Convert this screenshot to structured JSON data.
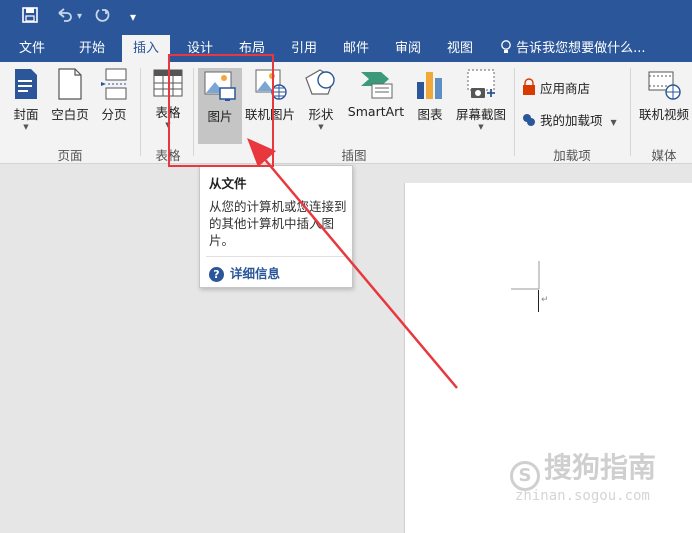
{
  "qat": {
    "save_icon": "save-icon",
    "undo_icon": "undo-icon",
    "redo_icon": "redo-icon",
    "customize_icon": "customize-icon"
  },
  "tabs": [
    {
      "label": "文件"
    },
    {
      "label": "开始"
    },
    {
      "label": "插入"
    },
    {
      "label": "设计"
    },
    {
      "label": "布局"
    },
    {
      "label": "引用"
    },
    {
      "label": "邮件"
    },
    {
      "label": "审阅"
    },
    {
      "label": "视图"
    }
  ],
  "tell_me": "告诉我您想要做什么...",
  "ribbon": {
    "pages": {
      "cover": "封面",
      "blank": "空白页",
      "break": "分页",
      "group": "页面"
    },
    "tables": {
      "table": "表格",
      "group": "表格"
    },
    "illustrations": {
      "picture": "图片",
      "online_picture": "联机图片",
      "shapes": "形状",
      "smartart": "SmartArt",
      "chart": "图表",
      "screenshot": "屏幕截图",
      "group": "插图"
    },
    "addins": {
      "store": "应用商店",
      "my_addins": "我的加载项",
      "group": "加载项"
    },
    "media": {
      "online_video": "联机视频",
      "group": "媒体"
    }
  },
  "tooltip": {
    "title": "从文件",
    "body": "从您的计算机或您连接到的其他计算机中插入图片。",
    "more": "详细信息"
  },
  "watermark": {
    "brand": "搜狗指南",
    "url": "zhinan.sogou.com"
  },
  "colors": {
    "accent": "#2b579a",
    "annotation": "#e8383d"
  }
}
